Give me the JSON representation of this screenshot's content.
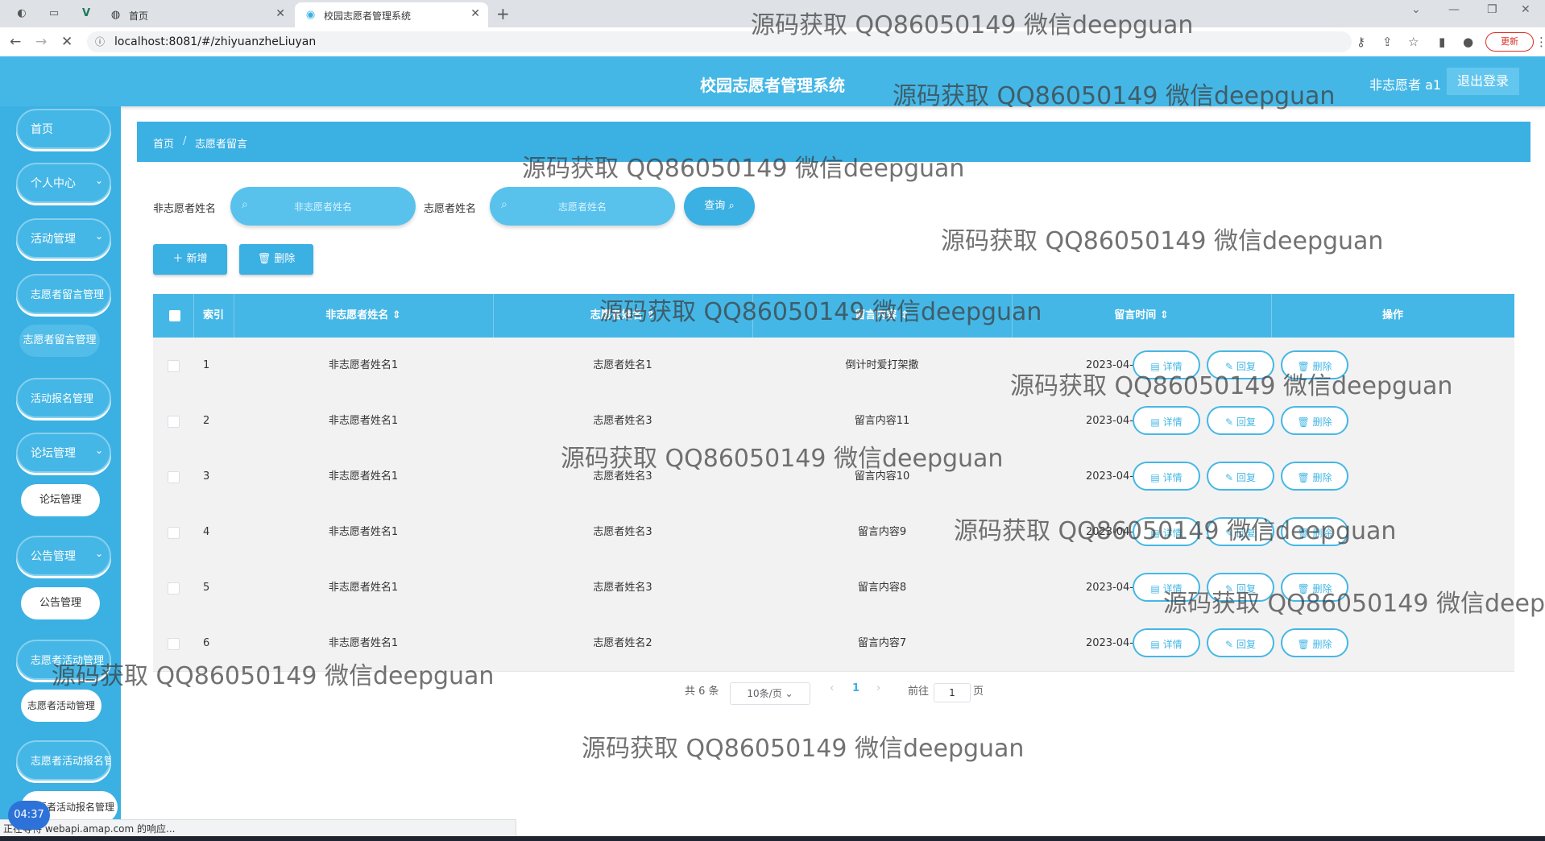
{
  "browser": {
    "tabs": [
      {
        "label": "首页",
        "active": false
      },
      {
        "label": "校园志愿者管理系统",
        "active": true
      }
    ],
    "url": "localhost:8081/#/zhiyuanzheLiuyan",
    "update_label": "更新",
    "status_text": "正在等待 webapi.amap.com 的响应..."
  },
  "app": {
    "title": "校园志愿者管理系统",
    "user": "非志愿者 a1",
    "logout": "退出登录"
  },
  "sidebar": {
    "items": [
      {
        "label": "首页",
        "has_chevron": false
      },
      {
        "label": "个人中心",
        "has_chevron": true
      },
      {
        "label": "活动管理",
        "has_chevron": true
      },
      {
        "label": "志愿者留言管理",
        "has_chevron": false
      },
      {
        "label": "活动报名管理",
        "has_chevron": false
      },
      {
        "label": "论坛管理",
        "has_chevron": true
      },
      {
        "label": "公告管理",
        "has_chevron": true
      },
      {
        "label": "志愿者活动管理",
        "has_chevron": false
      },
      {
        "label": "志愿者活动报名管",
        "has_chevron": false
      }
    ],
    "subitems": [
      "志愿者留言管理",
      "论坛管理",
      "公告管理",
      "志愿者活动管理",
      "志愿者活动报名管理"
    ]
  },
  "breadcrumb": {
    "home": "首页",
    "sep": "/",
    "current": "志愿者留言"
  },
  "search": {
    "label1": "非志愿者姓名",
    "placeholder1": "非志愿者姓名",
    "label2": "志愿者姓名",
    "placeholder2": "志愿者姓名",
    "query_label": "查询"
  },
  "actions": {
    "add": "＋ 新增",
    "delete": "删除"
  },
  "table": {
    "columns": [
      "索引",
      "非志愿者姓名",
      "志愿者姓名",
      "留言内容",
      "留言时间",
      "操作"
    ],
    "rows": [
      {
        "index": "1",
        "nonvolunteer": "非志愿者姓名1",
        "volunteer": "志愿者姓名1",
        "content": "倒计时爱打架撒",
        "time": "2023-04-01 15:54:56"
      },
      {
        "index": "2",
        "nonvolunteer": "非志愿者姓名1",
        "volunteer": "志愿者姓名3",
        "content": "留言内容11",
        "time": "2023-04-01 15:39:00"
      },
      {
        "index": "3",
        "nonvolunteer": "非志愿者姓名1",
        "volunteer": "志愿者姓名3",
        "content": "留言内容10",
        "time": "2023-04-01 15:39:00"
      },
      {
        "index": "4",
        "nonvolunteer": "非志愿者姓名1",
        "volunteer": "志愿者姓名3",
        "content": "留言内容9",
        "time": "2023-04-01 15:39:00"
      },
      {
        "index": "5",
        "nonvolunteer": "非志愿者姓名1",
        "volunteer": "志愿者姓名3",
        "content": "留言内容8",
        "time": "2023-04-01 15:39:00"
      },
      {
        "index": "6",
        "nonvolunteer": "非志愿者姓名1",
        "volunteer": "志愿者姓名2",
        "content": "留言内容7",
        "time": "2023-04-01 15:39:00"
      }
    ],
    "row_actions": {
      "detail": "详情",
      "reply": "回复",
      "delete": "删除"
    }
  },
  "pagination": {
    "total": "共 6 条",
    "page_size": "10条/页",
    "current_page": "1",
    "goto_label": "前往",
    "goto_value": "1",
    "page_suffix": "页"
  },
  "clock": "04:37",
  "watermark": "源码获取 QQ86050149 微信deepguan",
  "colors": {
    "primary": "#45b7e6",
    "sidebar": "#3bb0e3"
  }
}
